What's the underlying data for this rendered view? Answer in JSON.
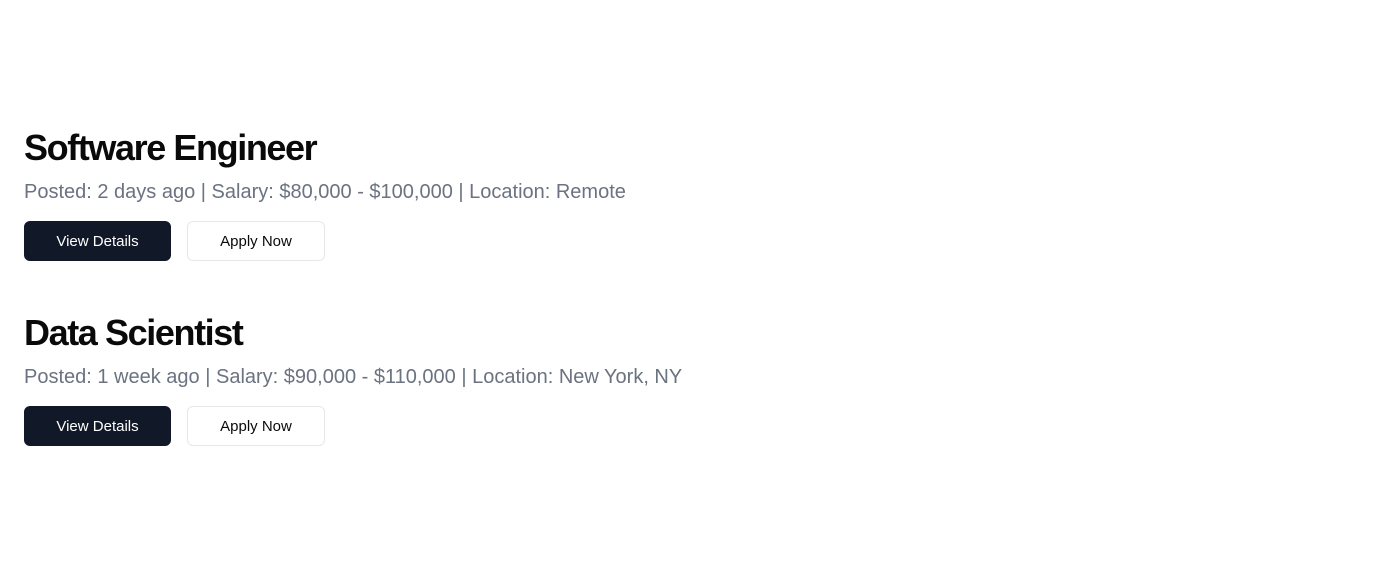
{
  "jobs": [
    {
      "title": "Software Engineer",
      "meta": "Posted: 2 days ago | Salary: $80,000 - $100,000 | Location: Remote",
      "view_details_label": "View Details",
      "apply_label": "Apply Now"
    },
    {
      "title": "Data Scientist",
      "meta": "Posted: 1 week ago | Salary: $90,000 - $110,000 | Location: New York, NY",
      "view_details_label": "View Details",
      "apply_label": "Apply Now"
    }
  ],
  "colors": {
    "background": "#ffffff",
    "title": "#0a0a0a",
    "meta": "#6b7280",
    "primary_button_bg": "#111827",
    "primary_button_text": "#ffffff",
    "secondary_button_border": "#e5e7eb"
  }
}
